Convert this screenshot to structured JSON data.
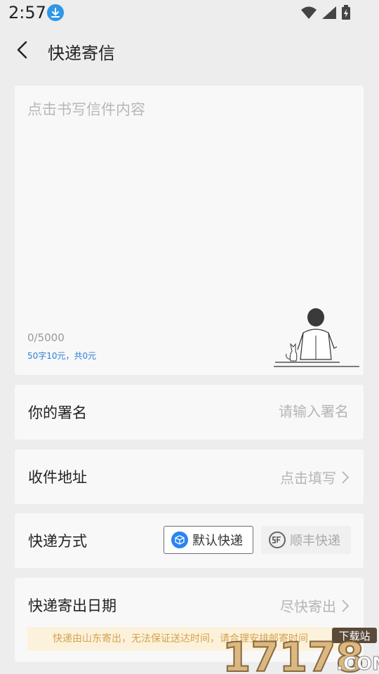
{
  "status_bar": {
    "time": "2:57"
  },
  "header": {
    "title": "快递寄信"
  },
  "letter": {
    "placeholder": "点击书写信件内容",
    "char_count": "0/5000",
    "price_note": "50字10元，共0元"
  },
  "signature": {
    "label": "你的署名",
    "placeholder": "请输入署名"
  },
  "address": {
    "label": "收件地址",
    "value": "点击填写"
  },
  "delivery_method": {
    "label": "快递方式",
    "options": [
      {
        "label": "默认快递",
        "icon": "box-icon",
        "selected": true
      },
      {
        "label": "顺丰快递",
        "icon": "sf-logo-icon",
        "selected": false
      }
    ]
  },
  "send_date": {
    "label": "快递寄出日期",
    "value": "尽快寄出",
    "notice": "快递由山东寄出，无法保证送达时间，请合理安排邮寄时间"
  },
  "watermark": {
    "top": "下载站",
    "main": "17178",
    "suffix": ".COM"
  },
  "colors": {
    "background": "#ededed",
    "card": "#f8f8f8",
    "accent": "#2b84f0",
    "notice_bg": "#fcf2dc",
    "notice_text": "#d5a24d"
  }
}
